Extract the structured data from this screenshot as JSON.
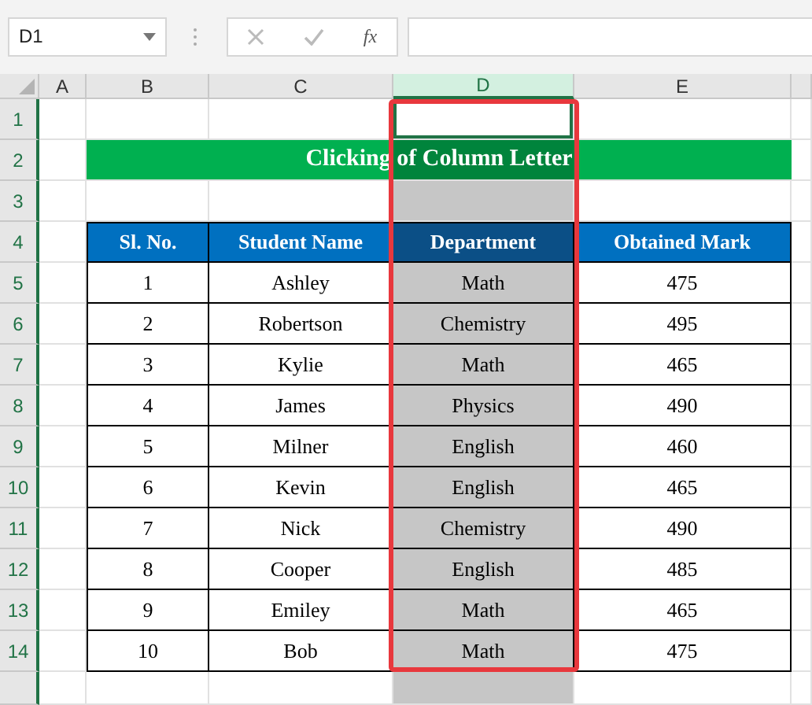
{
  "name_box": {
    "value": "D1"
  },
  "formula_bar": {
    "function_label": "fx"
  },
  "columns": [
    {
      "letter": "A",
      "selected": false
    },
    {
      "letter": "B",
      "selected": false
    },
    {
      "letter": "C",
      "selected": false
    },
    {
      "letter": "D",
      "selected": true
    },
    {
      "letter": "E",
      "selected": false
    }
  ],
  "rows": [
    "1",
    "2",
    "3",
    "4",
    "5",
    "6",
    "7",
    "8",
    "9",
    "10",
    "11",
    "12",
    "13",
    "14"
  ],
  "title": "Clicking of Column Letter",
  "table": {
    "columns": [
      "Sl. No.",
      "Student Name",
      "Department",
      "Obtained Mark"
    ],
    "rows": [
      [
        "1",
        "Ashley",
        "Math",
        "475"
      ],
      [
        "2",
        "Robertson",
        "Chemistry",
        "495"
      ],
      [
        "3",
        "Kylie",
        "Math",
        "465"
      ],
      [
        "4",
        "James",
        "Physics",
        "490"
      ],
      [
        "5",
        "Milner",
        "English",
        "460"
      ],
      [
        "6",
        "Kevin",
        "English",
        "465"
      ],
      [
        "7",
        "Nick",
        "Chemistry",
        "490"
      ],
      [
        "8",
        "Cooper",
        "English",
        "485"
      ],
      [
        "9",
        "Emiley",
        "Math",
        "465"
      ],
      [
        "10",
        "Bob",
        "Math",
        "475"
      ]
    ]
  }
}
